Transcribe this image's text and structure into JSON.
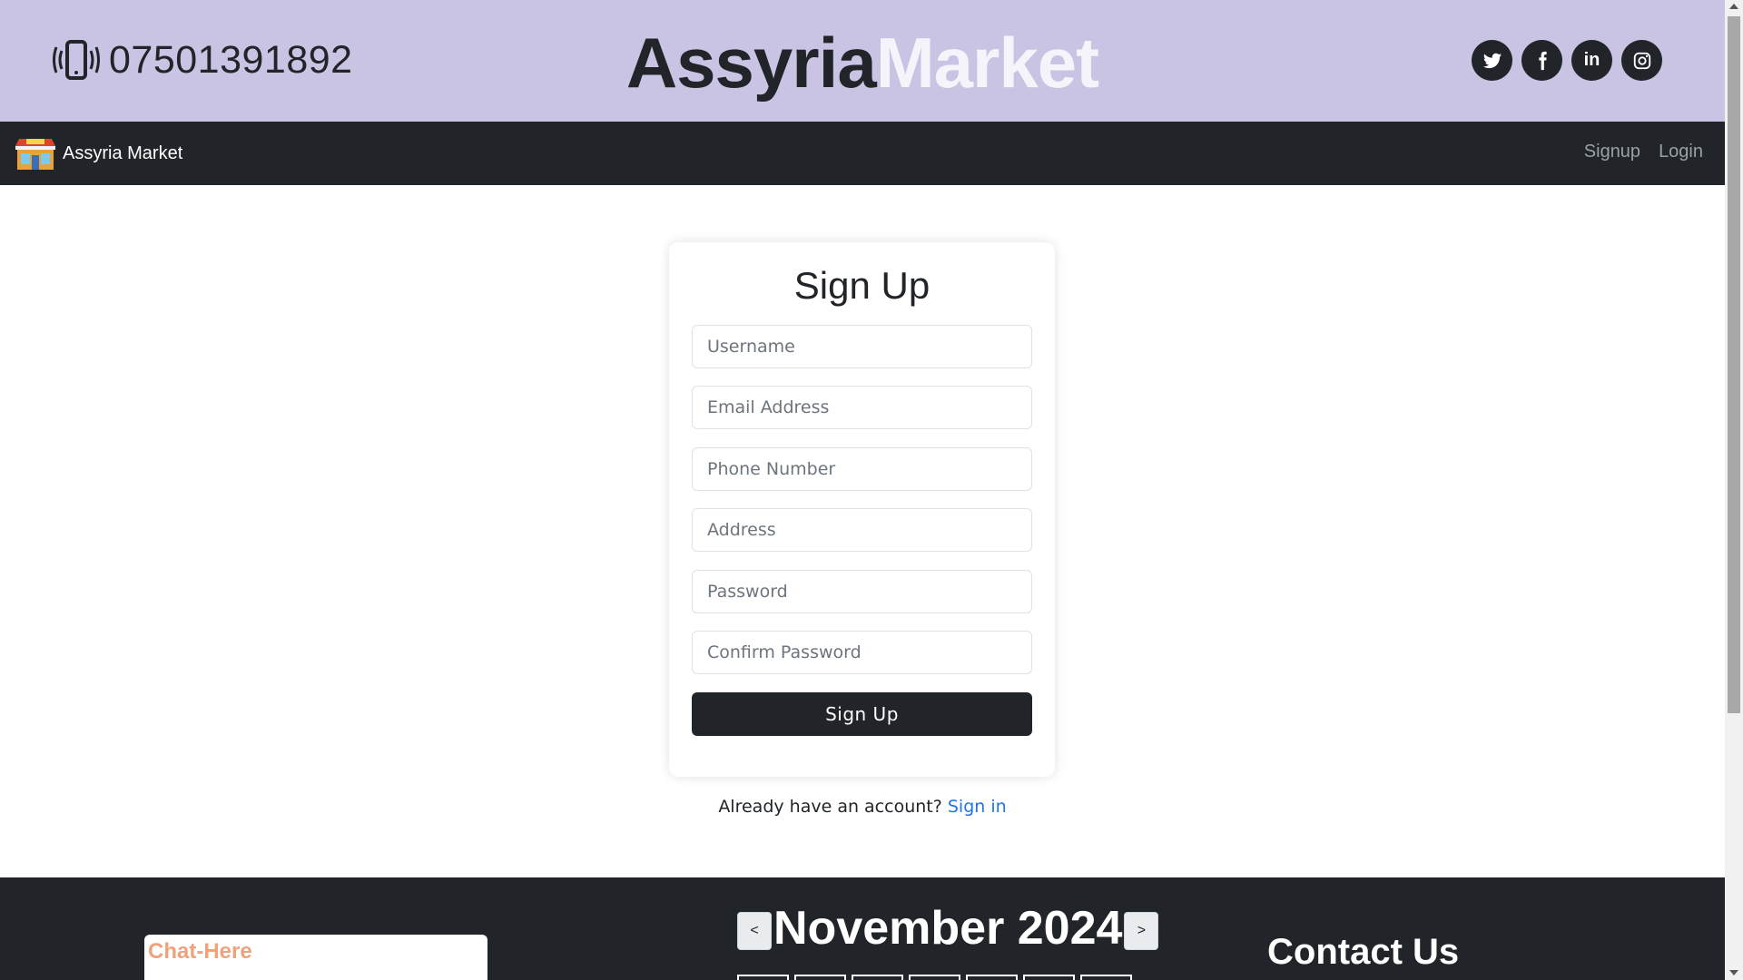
{
  "header": {
    "phone_icon": "vibrating-phone-icon",
    "phone_number": "07501391892",
    "brand_part1": "Assyria",
    "brand_part2": "Market",
    "socials": [
      {
        "name": "twitter-icon"
      },
      {
        "name": "facebook-icon"
      },
      {
        "name": "linkedin-icon",
        "label": "in"
      },
      {
        "name": "instagram-icon"
      }
    ]
  },
  "navbar": {
    "logo_icon": "market-store-icon",
    "brand": "Assyria Market",
    "links": {
      "signup": "Signup",
      "login": "Login"
    }
  },
  "signup_form": {
    "title": "Sign Up",
    "fields": {
      "username": "Username",
      "email": "Email Address",
      "phone": "Phone Number",
      "address": "Address",
      "password": "Password",
      "confirm_password": "Confirm Password"
    },
    "submit": "Sign Up"
  },
  "account_prompt": {
    "text": "Already have an account?",
    "link": "Sign in"
  },
  "footer": {
    "chat_label": "Chat-Here",
    "calendar": {
      "title": "November 2024",
      "prev": "<",
      "next": ">"
    },
    "contact_title": "Contact Us"
  },
  "colors": {
    "topbar": "#c9c3e4",
    "dark": "#212529",
    "link": "#1e74e8",
    "chat_label": "#f0a27a"
  }
}
